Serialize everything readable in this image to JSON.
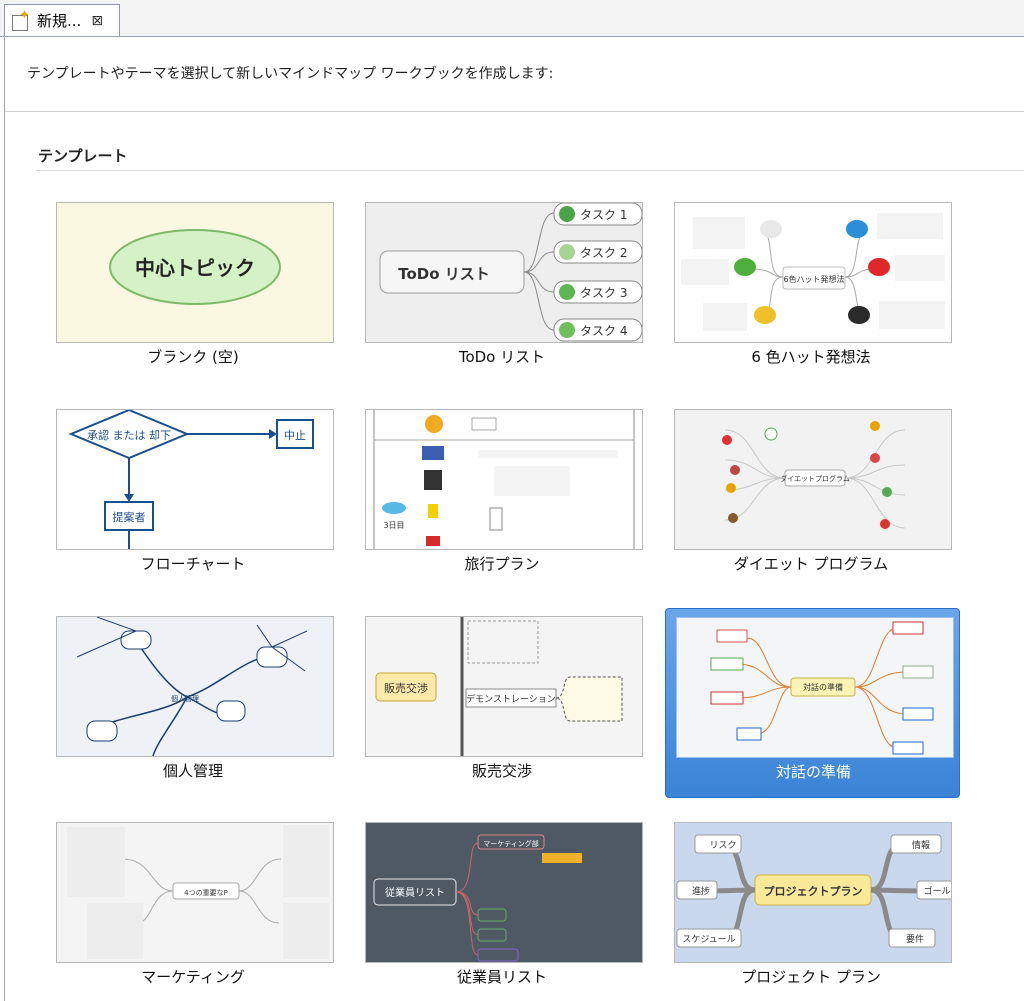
{
  "tab": {
    "label": "新規...",
    "close_glyph": "⊠"
  },
  "header": {
    "description": "テンプレートやテーマを選択して新しいマインドマップ ワークブックを作成します:"
  },
  "section": {
    "title": "テンプレート"
  },
  "templates": [
    {
      "label": "ブランク (空)",
      "thumb_text": "中心トピック"
    },
    {
      "label": "ToDo リスト",
      "thumb_text": "ToDo リスト",
      "tasks": [
        "タスク 1",
        "タスク 2",
        "タスク 3",
        "タスク 4"
      ]
    },
    {
      "label": "6 色ハット発想法",
      "thumb_text": "6色ハット発想法"
    },
    {
      "label": "フローチャート",
      "nodes": [
        "承認 または 却下",
        "中止",
        "提案者"
      ]
    },
    {
      "label": "旅行プラン",
      "thumb_text": "3日目"
    },
    {
      "label": "ダイエット プログラム",
      "thumb_text": "ダイエットプログラム"
    },
    {
      "label": "個人管理",
      "thumb_text": "個人管理"
    },
    {
      "label": "販売交渉",
      "thumb_text": "販売交渉",
      "branch": "デモンストレーション"
    },
    {
      "label": "対話の準備",
      "thumb_text": "対話の準備",
      "selected": true
    },
    {
      "label": "マーケティング",
      "thumb_text": "4つの重要なP"
    },
    {
      "label": "従業員リスト",
      "thumb_text": "従業員リスト",
      "branch": "マーケティング部"
    },
    {
      "label": "プロジェクト プラン",
      "thumb_text": "プロジェクトプラン",
      "items": [
        "リスク",
        "情報",
        "進捗",
        "ゴール",
        "スケジュール",
        "要件"
      ]
    }
  ]
}
